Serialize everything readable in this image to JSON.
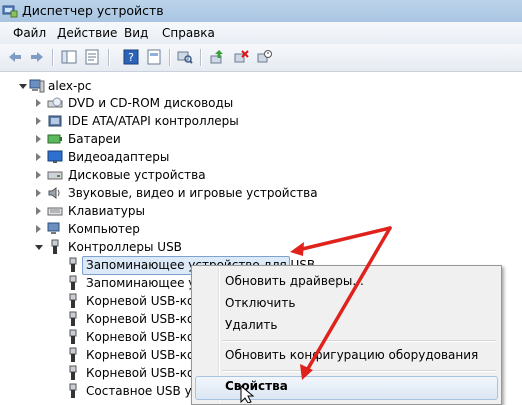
{
  "window": {
    "title": "Диспетчер устройств"
  },
  "menu": {
    "items": [
      "Файл",
      "Действие",
      "Вид",
      "Справка"
    ]
  },
  "tree": {
    "root": "alex-pc",
    "categories": [
      "DVD и CD-ROM дисководы",
      "IDE ATA/ATAPI контроллеры",
      "Батареи",
      "Видеоадаптеры",
      "Дисковые устройства",
      "Звуковые, видео и игровые устройства",
      "Клавиатуры",
      "Компьютер",
      "Контроллеры USB"
    ],
    "usb_children": [
      "Запоминающее устройство для USB",
      "Запоминающее устр",
      "Корневой USB-конц",
      "Корневой USB-конц",
      "Корневой USB-конц",
      "Корневой USB-конц",
      "Корневой USB-конц",
      "Составное USB устр"
    ]
  },
  "context_menu": {
    "items": [
      "Обновить драйверы...",
      "Отключить",
      "Удалить",
      "Обновить конфигурацию оборудования",
      "Свойства"
    ]
  },
  "colors": {
    "annotation_red": "#e0221c",
    "selection": "#dce9f8"
  }
}
